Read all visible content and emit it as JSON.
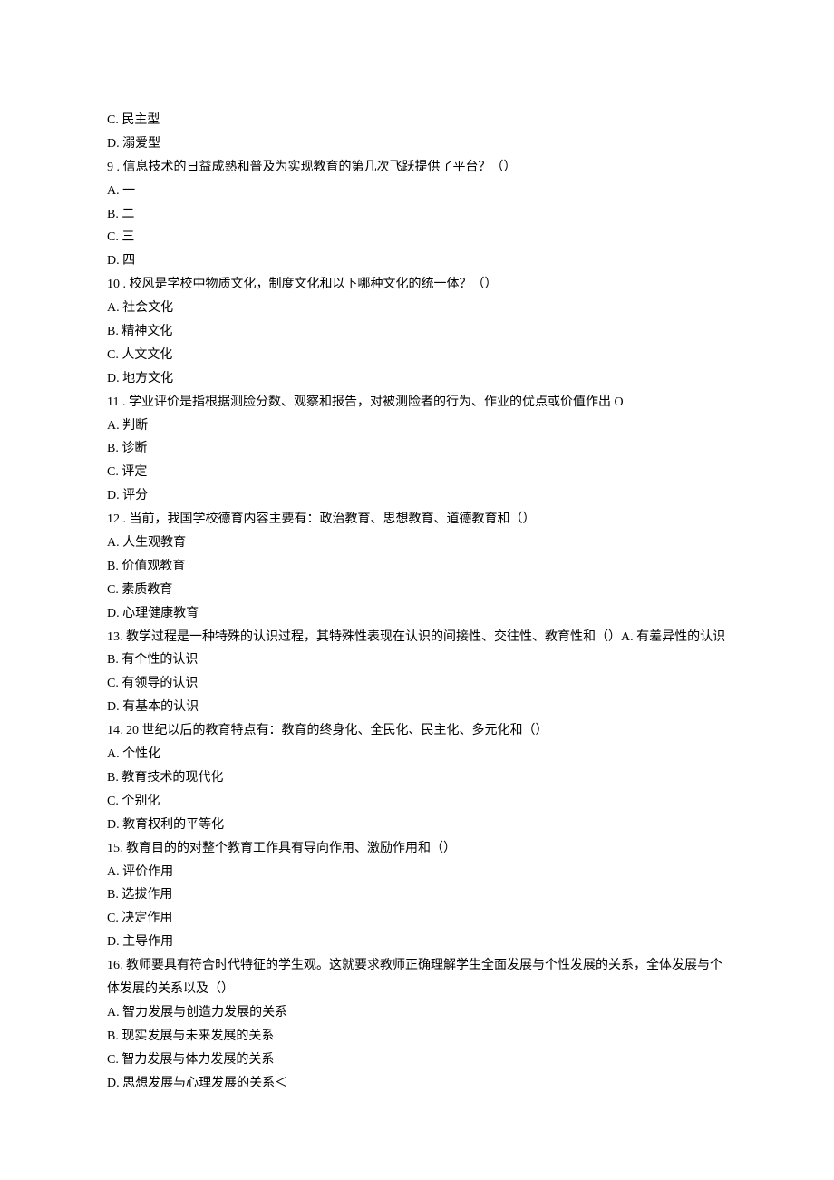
{
  "lines": [
    "C. 民主型",
    "D. 溺爱型",
    "9  . 信息技术的日益成熟和普及为实现教育的第几次飞跃提供了平台？（）",
    "A. 一",
    "B. 二",
    "C. 三",
    "D. 四",
    "10  . 校风是学校中物质文化，制度文化和以下哪种文化的统一体？（）",
    "A. 社会文化",
    "B. 精神文化",
    "C. 人文文化",
    "D. 地方文化",
    "11  . 学业评价是指根据测脸分数、观察和报告，对被测险者的行为、作业的优点或价值作出 O",
    "A. 判断",
    "B. 诊断",
    "C. 评定",
    "D. 评分",
    "12  . 当前，我国学校德育内容主要有：政治教育、思想教育、道德教育和（）",
    "A. 人生观教育",
    "B. 价值观教育",
    "C. 素质教育",
    "D. 心理健康教育",
    "13. 教学过程是一种特殊的认识过程，其特殊性表现在认识的间接性、交往性、教育性和（）A. 有差异性的认识",
    "B. 有个性的认识",
    "C. 有领导的认识",
    "D. 有基本的认识",
    "14. 20 世纪以后的教育特点有：教育的终身化、全民化、民主化、多元化和（）",
    "A. 个性化",
    "B. 教育技术的现代化",
    "C. 个别化",
    "D. 教育权利的平等化",
    "15. 教育目的的对整个教育工作具有导向作用、激励作用和（）",
    "A. 评价作用",
    "B. 选拔作用",
    "C. 决定作用",
    "D. 主导作用",
    "16. 教师要具有符合时代特征的学生观。这就要求教师正确理解学生全面发展与个性发展的关系，全体发展与个体发展的关系以及（）",
    "A. 智力发展与创造力发展的关系",
    "B. 现实发展与未来发展的关系",
    "C. 智力发展与体力发展的关系",
    "D. 思想发展与心理发展的关系＜"
  ]
}
